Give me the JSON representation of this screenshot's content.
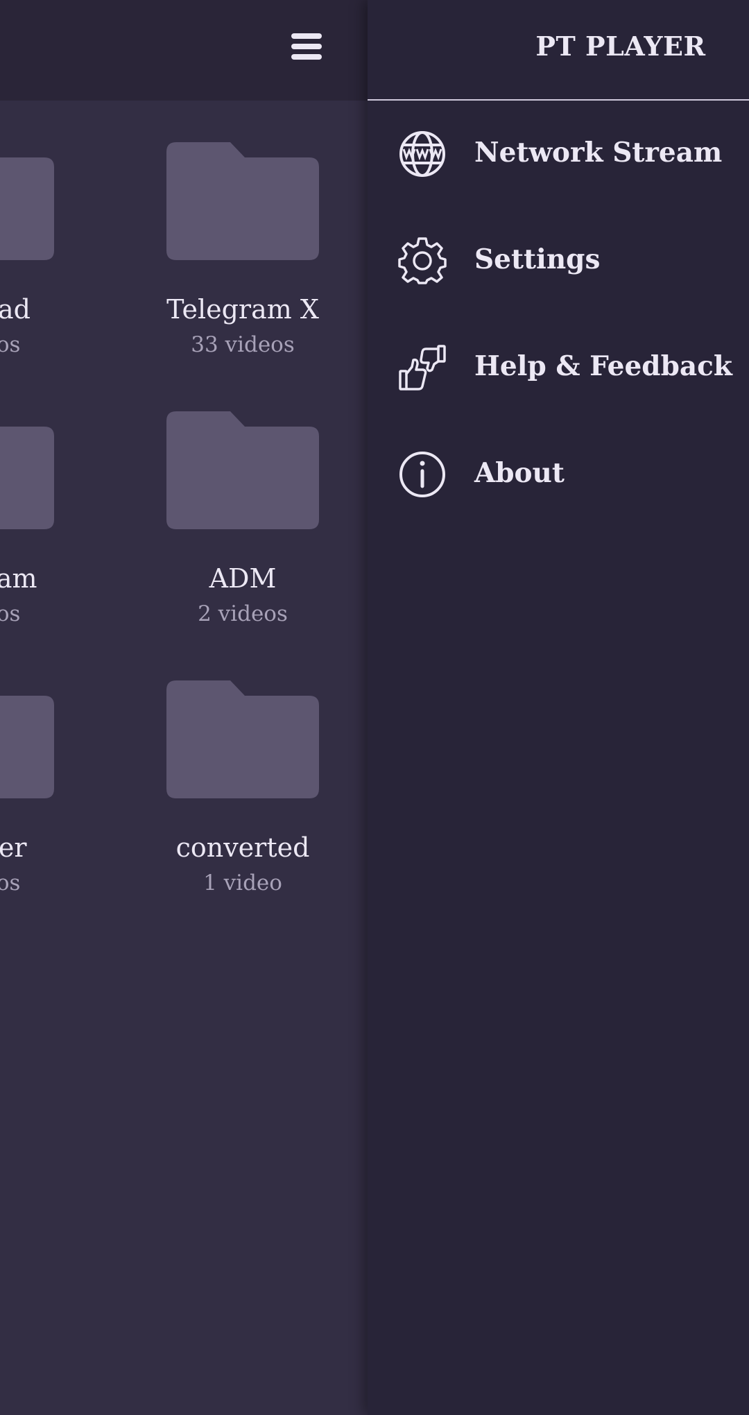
{
  "app": {
    "title": "PT PLAYER"
  },
  "colors": {
    "main_background": "#332e44",
    "topbar_background": "#2a2538",
    "drawer_background": "#282438",
    "folder_icon": "#5d5670",
    "primary_text": "#ece8f4",
    "secondary_text": "#a8a2b8"
  },
  "main": {
    "menu_icon": "hamburger-menu-icon",
    "folders": [
      {
        "name": "load",
        "count": "eos"
      },
      {
        "name": "Telegram X",
        "count": "33 videos"
      },
      {
        "name": "gram",
        "count": "eos"
      },
      {
        "name": "ADM",
        "count": "2 videos"
      },
      {
        "name": "tter",
        "count": "eos"
      },
      {
        "name": "converted",
        "count": "1 video"
      }
    ]
  },
  "drawer": {
    "items": [
      {
        "label": "Network Stream",
        "icon": "globe-www-icon"
      },
      {
        "label": "Settings",
        "icon": "gear-icon"
      },
      {
        "label": "Help & Feedback",
        "icon": "thumbs-up-down-icon"
      },
      {
        "label": "About",
        "icon": "info-icon"
      }
    ]
  }
}
